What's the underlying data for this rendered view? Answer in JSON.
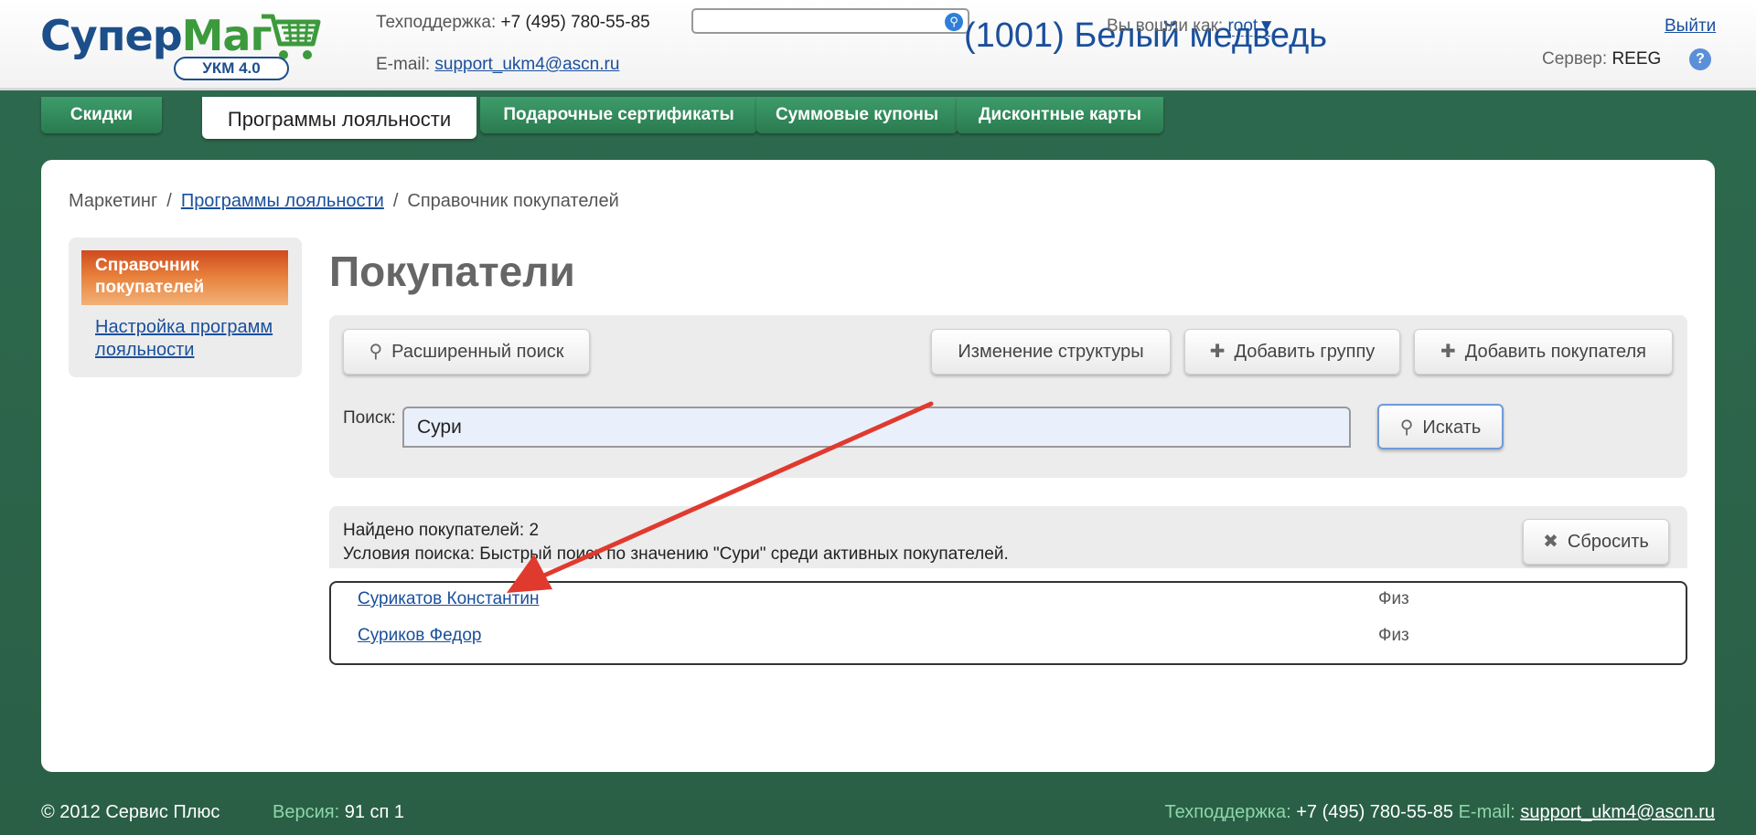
{
  "header": {
    "logo_main": "Супер",
    "logo_accent": "Маг",
    "logo_badge": "УКМ 4.0",
    "support_phone_label": "Техподдержка:",
    "support_phone": "+7 (495) 780-55-85",
    "support_email_label": "E-mail:",
    "support_email": "support_ukm4@ascn.ru",
    "top_search_value": "",
    "store_name": "(1001) Белый медведь",
    "login_label": "Вы вошли как:",
    "login_user": "root▼",
    "logout": "Выйти",
    "server_label": "Сервер:",
    "server_value": "REEG",
    "help": "?"
  },
  "tabs": [
    {
      "label": "Скидки"
    },
    {
      "label": "Программы лояльности"
    },
    {
      "label": "Подарочные сертификаты"
    },
    {
      "label": "Суммовые купоны"
    },
    {
      "label": "Дисконтные карты"
    }
  ],
  "breadcrumb": {
    "item1": "Маркетинг",
    "item2": "Программы лояльности",
    "item3": "Справочник покупателей",
    "sep": "/"
  },
  "sidebar": {
    "active": "Справочник покупателей",
    "link": "Настройка программ лояльности"
  },
  "page_title": "Покупатели",
  "toolbar": {
    "advanced_search": "Расширенный поиск",
    "change_structure": "Изменение структуры",
    "add_group": "Добавить группу",
    "add_customer": "Добавить покупателя",
    "search_label": "Поиск:",
    "search_value": "Сури",
    "search_button": "Искать"
  },
  "results": {
    "found": "Найдено покупателей: 2",
    "conditions": "Условия поиска: Быстрый поиск по значению \"Сури\" среди активных покупателей.",
    "reset": "Сбросить",
    "rows": [
      {
        "name": "Сурикатов Константин",
        "type": "Физ"
      },
      {
        "name": "Суриков Федор",
        "type": "Физ"
      }
    ]
  },
  "footer": {
    "copyright": "© 2012 Сервис Плюс",
    "version_label": "Версия:",
    "version": "91 сп 1",
    "support_label": "Техподдержка:",
    "support_phone": "+7 (495) 780-55-85",
    "email_label": "E-mail:",
    "email": "support_ukm4@ascn.ru"
  },
  "colors": {
    "brand_green": "#2d6a4e",
    "link_blue": "#1a4f9c",
    "active_orange": "#d04a1e",
    "annotation_red": "#e03a2f"
  }
}
